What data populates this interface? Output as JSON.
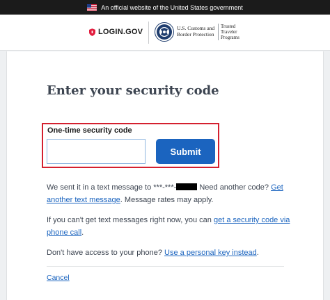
{
  "gov_banner": {
    "text": "An official website of the United States government"
  },
  "header": {
    "login_logo_text": "LOGIN.GOV",
    "agency_name": "U.S. Customs and Border Protection",
    "program_name": "Trusted Traveler Programs"
  },
  "main": {
    "title": "Enter your security code",
    "field_label": "One-time security code",
    "code_value": "",
    "submit_label": "Submit",
    "message": {
      "prefix": "We sent it in a text message to ***-***-",
      "phone_suffix_masked": true,
      "middle": " Need another code? ",
      "link_text": "Get another text message",
      "suffix": ". Message rates may apply."
    },
    "phone_call": {
      "prefix": "If you can't get text messages right now, you can ",
      "link_text": "get a security code via phone call",
      "suffix": "."
    },
    "personal_key": {
      "prefix": "Don't have access to your phone? ",
      "link_text": "Use a personal key instead",
      "suffix": "."
    },
    "cancel_label": "Cancel"
  },
  "colors": {
    "accent_blue": "#1b64bf",
    "highlight_red": "#d4202f",
    "banner_bg": "#1b1b1b"
  }
}
